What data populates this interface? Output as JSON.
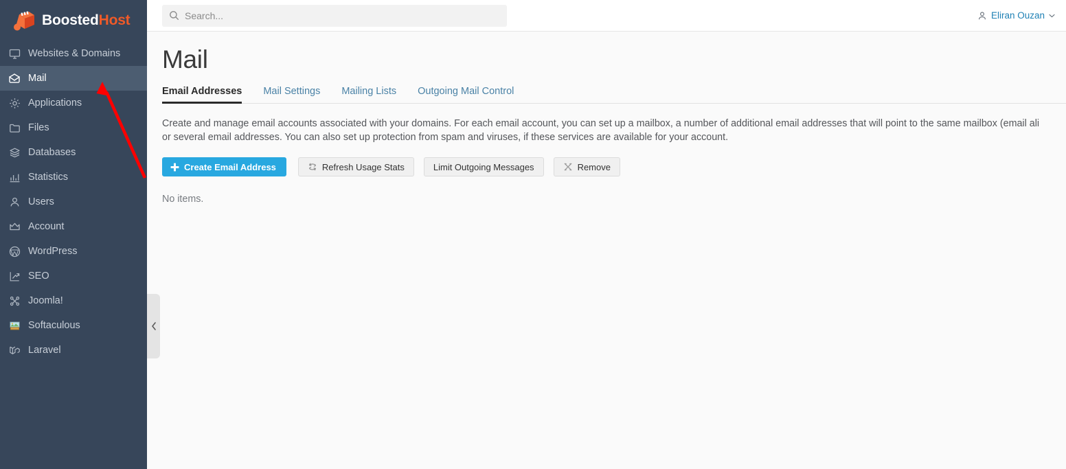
{
  "brand": {
    "name_primary": "Boosted",
    "name_accent": "Host",
    "accent_color": "#f05a28",
    "logo_icon": "cube-box-icon"
  },
  "sidebar": {
    "background_color": "#37465a",
    "active_background_color": "#4c5d71",
    "items": [
      {
        "label": "Websites & Domains",
        "icon": "monitor-icon",
        "active": false
      },
      {
        "label": "Mail",
        "icon": "envelope-icon",
        "active": true
      },
      {
        "label": "Applications",
        "icon": "gear-icon",
        "active": false
      },
      {
        "label": "Files",
        "icon": "folder-icon",
        "active": false
      },
      {
        "label": "Databases",
        "icon": "layers-icon",
        "active": false
      },
      {
        "label": "Statistics",
        "icon": "bar-chart-icon",
        "active": false
      },
      {
        "label": "Users",
        "icon": "person-icon",
        "active": false
      },
      {
        "label": "Account",
        "icon": "crown-icon",
        "active": false
      },
      {
        "label": "WordPress",
        "icon": "wordpress-icon",
        "active": false
      },
      {
        "label": "SEO",
        "icon": "trend-arrow-icon",
        "active": false
      },
      {
        "label": "Joomla!",
        "icon": "joomla-icon",
        "active": false
      },
      {
        "label": "Softaculous",
        "icon": "softaculous-icon",
        "active": false
      },
      {
        "label": "Laravel",
        "icon": "laravel-icon",
        "active": false
      }
    ],
    "collapse_handle_icon": "chevron-left-icon"
  },
  "topbar": {
    "search": {
      "placeholder": "Search...",
      "value": "",
      "icon": "search-icon"
    },
    "user": {
      "name": "Eliran Ouzan",
      "icon": "person-icon",
      "caret_icon": "chevron-down-icon",
      "link_color": "#1f81b5"
    }
  },
  "page": {
    "title": "Mail",
    "tabs": [
      {
        "label": "Email Addresses",
        "active": true
      },
      {
        "label": "Mail Settings",
        "active": false
      },
      {
        "label": "Mailing Lists",
        "active": false
      },
      {
        "label": "Outgoing Mail Control",
        "active": false
      }
    ],
    "description": "Create and manage email accounts associated with your domains. For each email account, you can set up a mailbox, a number of additional email addresses that will point to the same mailbox (email ali\nor several email addresses. You can also set up protection from spam and viruses, if these services are available for your account.",
    "actions": [
      {
        "label": "Create Email Address",
        "icon": "plus-icon",
        "style": "primary"
      },
      {
        "label": "Refresh Usage Stats",
        "icon": "refresh-icon",
        "style": "secondary"
      },
      {
        "label": "Limit Outgoing Messages",
        "icon": "none",
        "style": "secondary"
      },
      {
        "label": "Remove",
        "icon": "x-cross-icon",
        "style": "secondary"
      }
    ],
    "empty_state": "No items."
  },
  "annotation": {
    "type": "arrow",
    "color": "#ff0000",
    "points_to": "Mail"
  }
}
